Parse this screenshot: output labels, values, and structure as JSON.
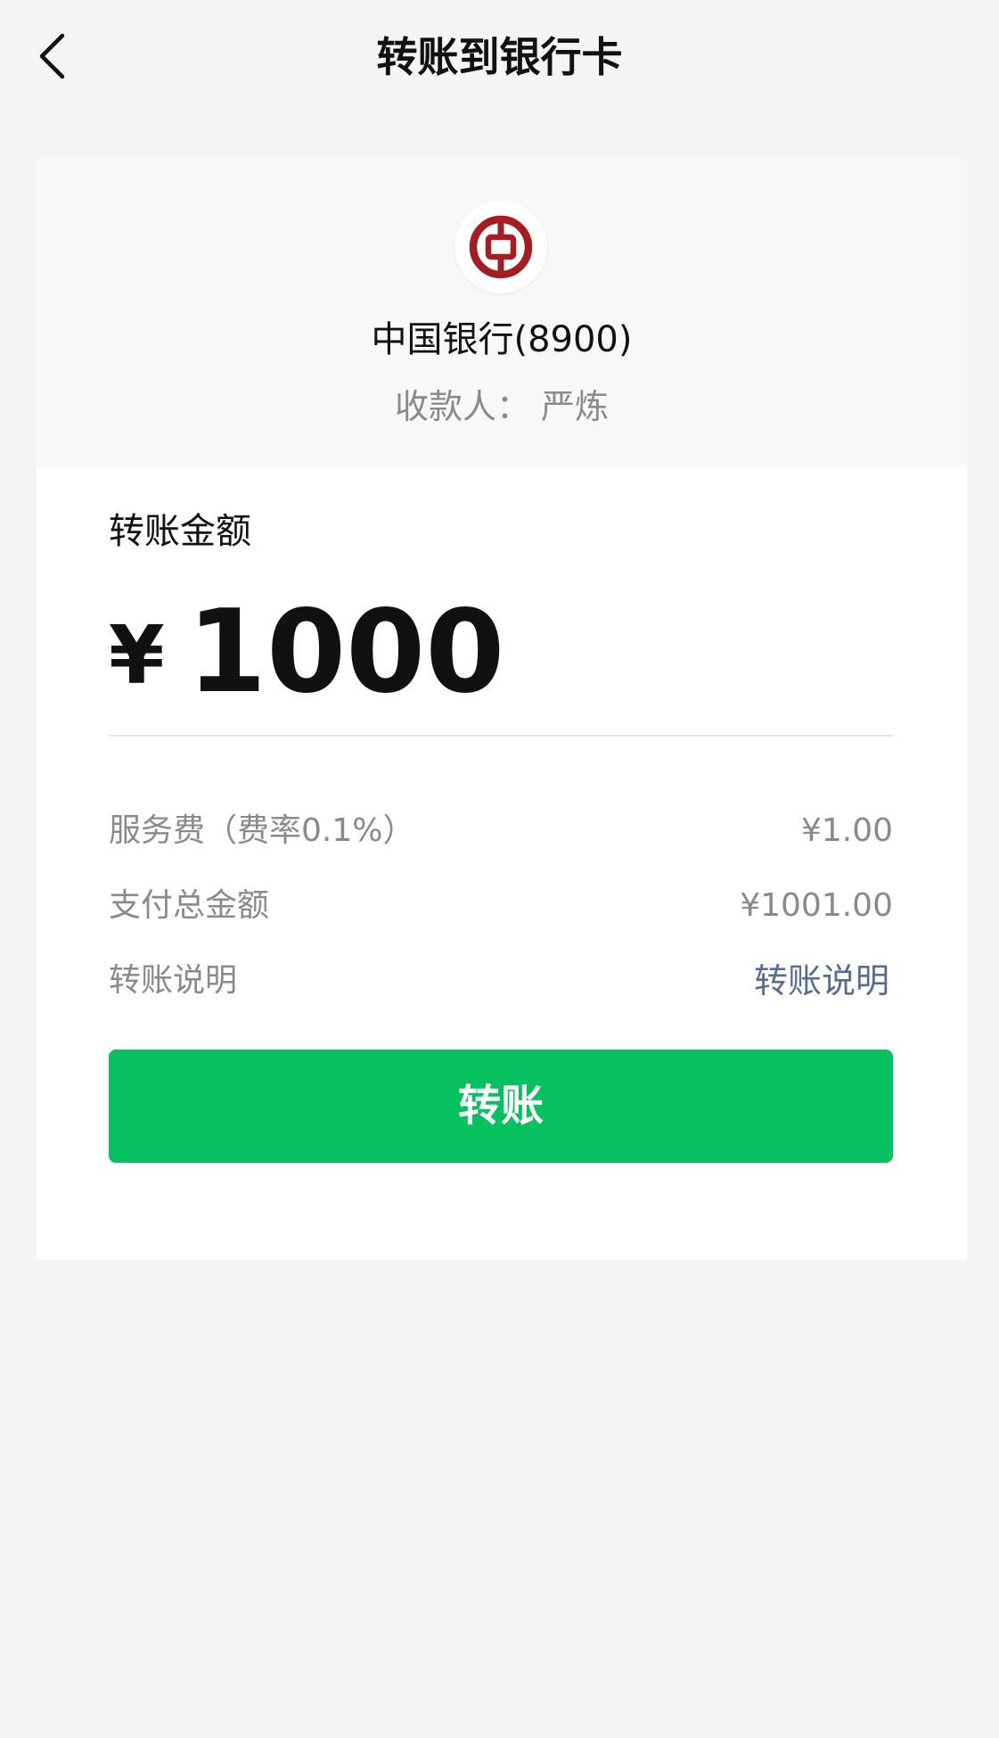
{
  "nav": {
    "title": "转账到银行卡",
    "back_icon": "chevron-left-icon"
  },
  "bank": {
    "name": "中国银行(8900)",
    "payee": "收款人： 严炼",
    "logo_icon": "bank-of-china-logo",
    "logo_color": "#a51d22"
  },
  "amount": {
    "label": "转账金额",
    "currency": "¥",
    "value": "1000"
  },
  "details": {
    "fee_label": "服务费（费率0.1%）",
    "fee_value": "¥1.00",
    "total_label": "支付总金额",
    "total_value": "¥1001.00",
    "note_label": "转账说明",
    "note_link": "转账说明"
  },
  "actions": {
    "transfer_label": "转账"
  },
  "colors": {
    "primary_green": "#07c160",
    "link_blue": "#576b95",
    "page_bg": "#f4f4f4"
  }
}
